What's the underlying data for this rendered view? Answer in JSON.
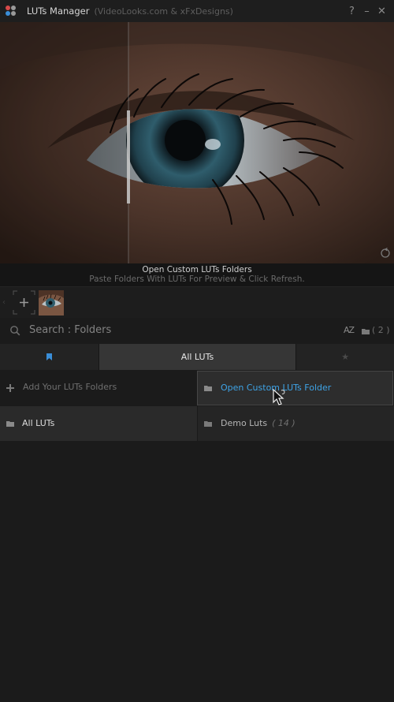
{
  "window": {
    "title": "LUTs Manager",
    "subtitle": "(VideoLooks.com & xFxDesigns)",
    "controls": {
      "help": "?",
      "minimize": "–",
      "close": "✕"
    }
  },
  "preview": {
    "caption_title": "Open Custom LUTs Folders",
    "caption_hint": "Paste Folders With LUTs For Preview & Click Refresh."
  },
  "search": {
    "label": "Search : Folders",
    "sort_label": "AZ",
    "folder_count": "( 2 )"
  },
  "tabs": [
    {
      "label": ""
    },
    {
      "label": "All LUTs"
    },
    {
      "label": "★"
    }
  ],
  "folders": {
    "add_label": "Add Your LUTs Folders",
    "open_custom_label": "Open Custom LUTs Folder",
    "all_luts_label": "All LUTs",
    "demo_label": "Demo Luts",
    "demo_count": "( 14 )"
  },
  "colors": {
    "accent": "#3ea3e6",
    "background": "#1b1b1b",
    "active_tab": "#363636"
  },
  "icons": [
    "app-logo-icon",
    "help-icon",
    "minimize-icon",
    "close-icon",
    "reset-icon",
    "add-icon",
    "search-icon",
    "sort-az-icon",
    "folder-icon",
    "bookmark-icon",
    "star-icon",
    "pointer-cursor-icon"
  ]
}
